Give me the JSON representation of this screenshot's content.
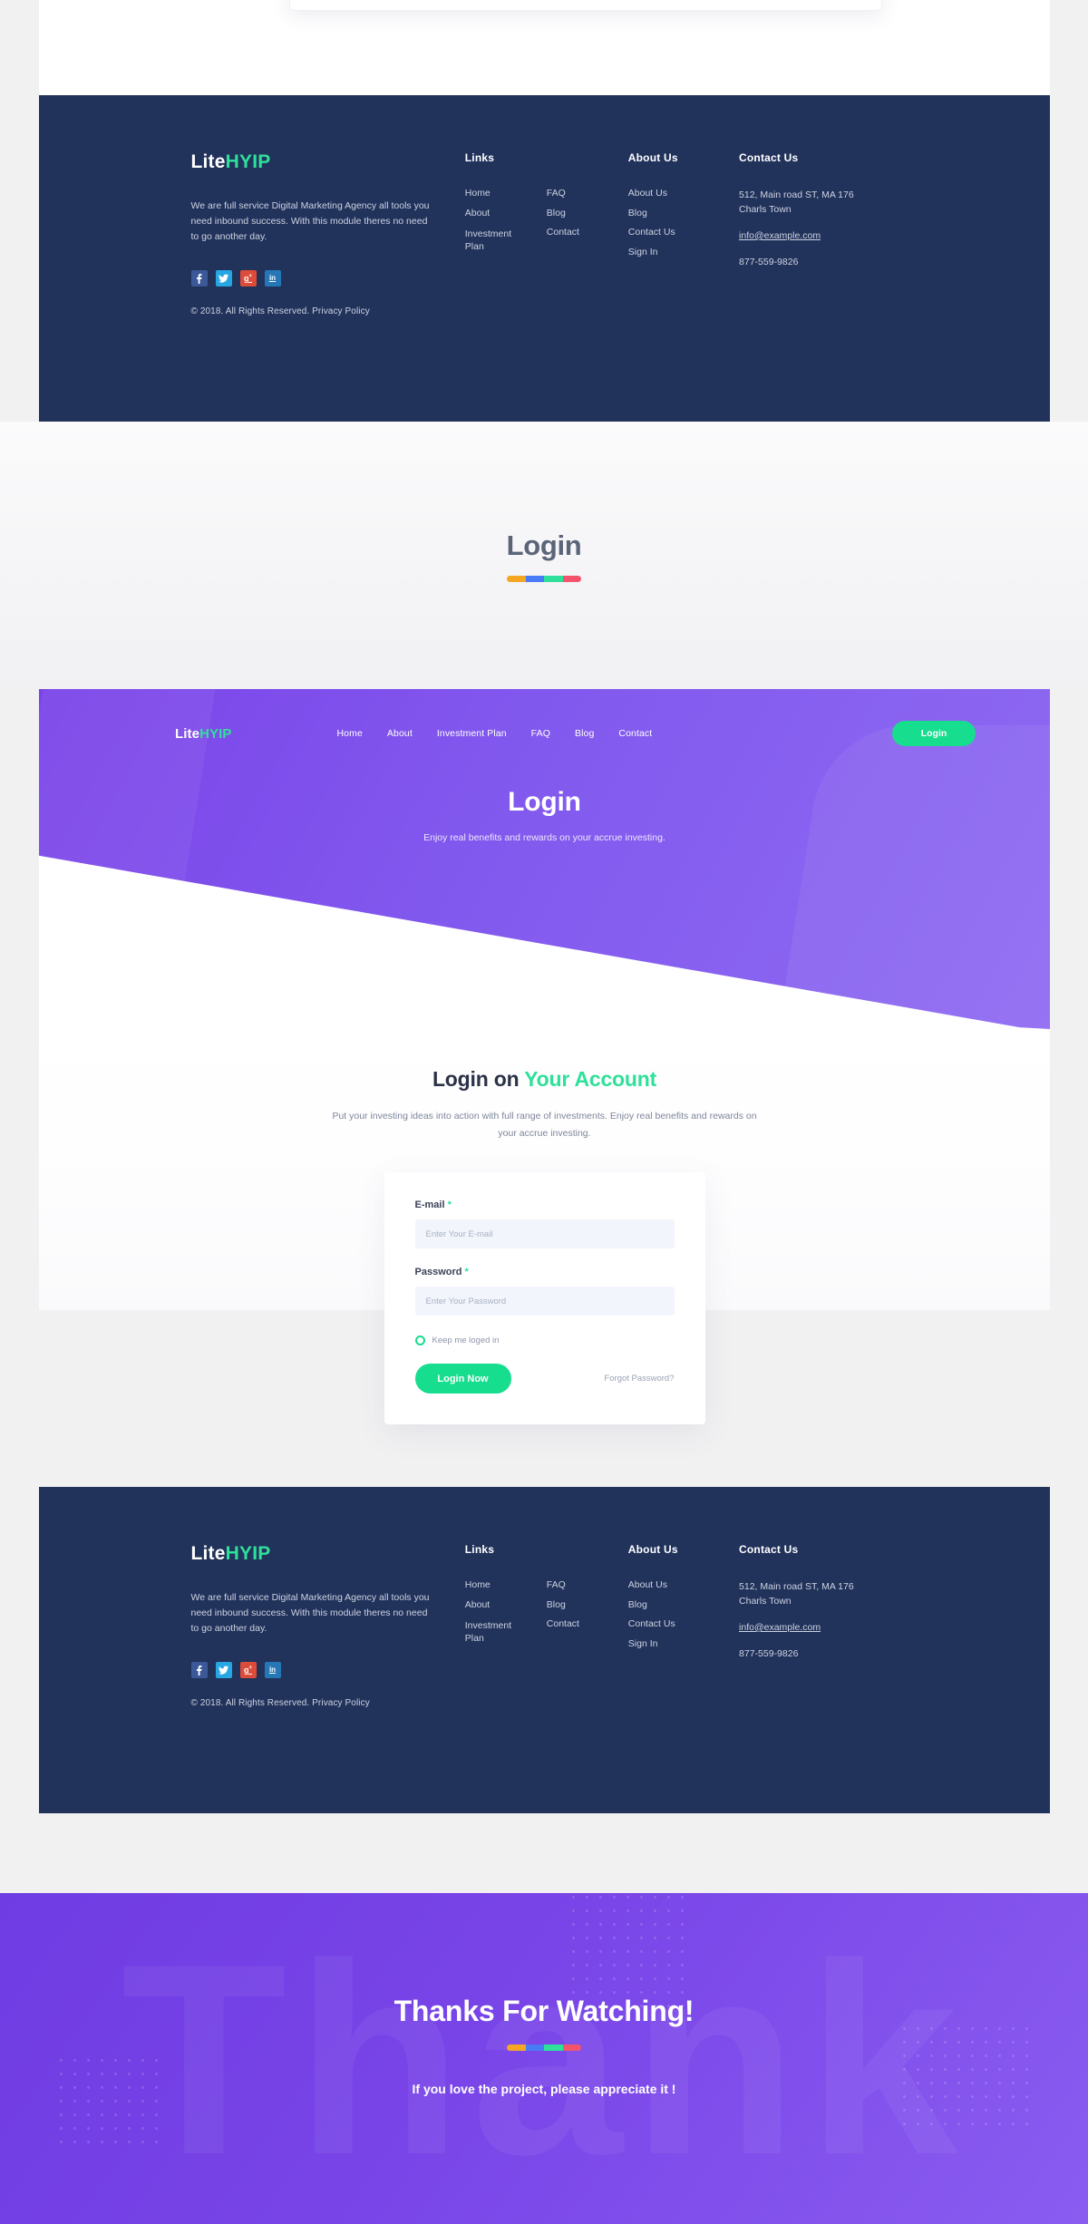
{
  "site": {
    "logo_lite": "Lite",
    "logo_hyip": "HYIP"
  },
  "colors": {
    "purple": "#7B43E8",
    "purple_light": "#8F6BF2",
    "navy": "#21325B",
    "green": "#17DD8E",
    "green_logo": "#2FE09A",
    "page_bg": "#F1F1F2",
    "rainbow": [
      "#F5A623",
      "#4A7BF7",
      "#2FE09A",
      "#F4556C"
    ]
  },
  "footer": {
    "logo_lite": "Lite",
    "logo_hyip": "HYIP",
    "description": "We are full service Digital Marketing Agency all tools you need inbound success. With this module theres no need to go another day.",
    "links_heading": "Links",
    "links_col1": [
      "Home",
      "About",
      "Investment Plan"
    ],
    "links_col2": [
      "FAQ",
      "Blog",
      "Contact"
    ],
    "about_heading": "About Us",
    "about_items": [
      "About Us",
      "Blog",
      "Contact Us",
      "Sign In"
    ],
    "contact_heading": "Contact Us",
    "address_line1": "512, Main road ST, MA 176",
    "address_line2": "Charls Town",
    "email": "info@example.com",
    "phone": "877-559-9826",
    "social": [
      {
        "name": "facebook",
        "label": "f",
        "color": "#3B5998"
      },
      {
        "name": "twitter",
        "label": "t",
        "color": "#26A6E3"
      },
      {
        "name": "google-plus",
        "label": "g+",
        "color": "#DD4B39"
      },
      {
        "name": "linkedin",
        "label": "in",
        "color": "#2578B5"
      }
    ],
    "copyright": "© 2018. All Rights Reserved. Privacy Policy"
  },
  "label_section": {
    "title": "Login"
  },
  "hero": {
    "logo_lite": "Lite",
    "logo_hyip": "HYIP",
    "nav": [
      "Home",
      "About",
      "Investment Plan",
      "FAQ",
      "Blog",
      "Contact"
    ],
    "login_button": "Login",
    "title": "Login",
    "subtitle": "Enjoy real benefits and rewards on  your accrue investing."
  },
  "form": {
    "heading_dark": "Login on ",
    "heading_accent": "Your Account",
    "paragraph": "Put your investing ideas into action with full range of  investments. Enjoy real benefits and rewards on your accrue investing.",
    "email_label": "E-mail",
    "email_required": "*",
    "email_placeholder": "Enter Your E-mail",
    "email_value": "",
    "password_label": "Password",
    "password_required": "*",
    "password_placeholder": "Enter Your Password",
    "password_value": "",
    "keep_logged_in": "Keep me loged in",
    "submit_button": "Login Now",
    "forgot_link": "Forgot Password?"
  },
  "thanks": {
    "bg_text": "Thank",
    "title": "Thanks For Watching!",
    "subtitle": "If you love the project, please appreciate it !"
  }
}
